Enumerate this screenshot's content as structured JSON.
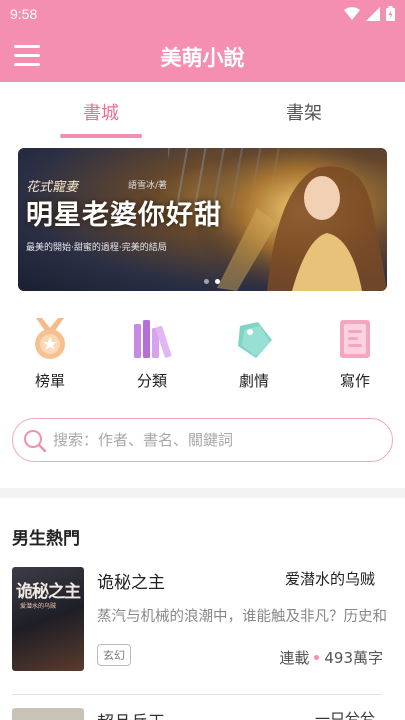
{
  "status_bar": {
    "time": "9:58"
  },
  "app_bar": {
    "title": "美萌小說"
  },
  "tabs": [
    {
      "label": "書城",
      "active": true
    },
    {
      "label": "書架",
      "active": false
    }
  ],
  "banner": {
    "subtitle": "花式寵妻",
    "author": "語雪冰/著",
    "title": "明星老婆你好甜",
    "tagline": "最美的開始·甜蜜的過程·完美的結局",
    "dots": 2,
    "active_dot": 1
  },
  "quick_links": [
    {
      "label": "榜單",
      "icon": "medal-icon"
    },
    {
      "label": "分類",
      "icon": "books-icon"
    },
    {
      "label": "劇情",
      "icon": "tag-icon"
    },
    {
      "label": "寫作",
      "icon": "notepad-icon"
    }
  ],
  "search": {
    "placeholder": "搜索：作者、書名、關鍵詞"
  },
  "section": {
    "title": "男生熱門"
  },
  "books": [
    {
      "title": "诡秘之主",
      "author": "爱潜水的乌贼",
      "description": "蒸汽与机械的浪潮中，谁能触及非凡？历史和黑暗",
      "tag": "玄幻",
      "status": "連載",
      "word_count": "493萬字",
      "cover_text": "诡秘之主",
      "cover_subtitle": "爱潜水的乌贼"
    }
  ],
  "next_book": {
    "title": "超品兵王",
    "author": "一只兮兮"
  },
  "colors": {
    "primary": "#f48fb1",
    "accent": "#ec6f8f",
    "indicator": "#f08fae"
  }
}
